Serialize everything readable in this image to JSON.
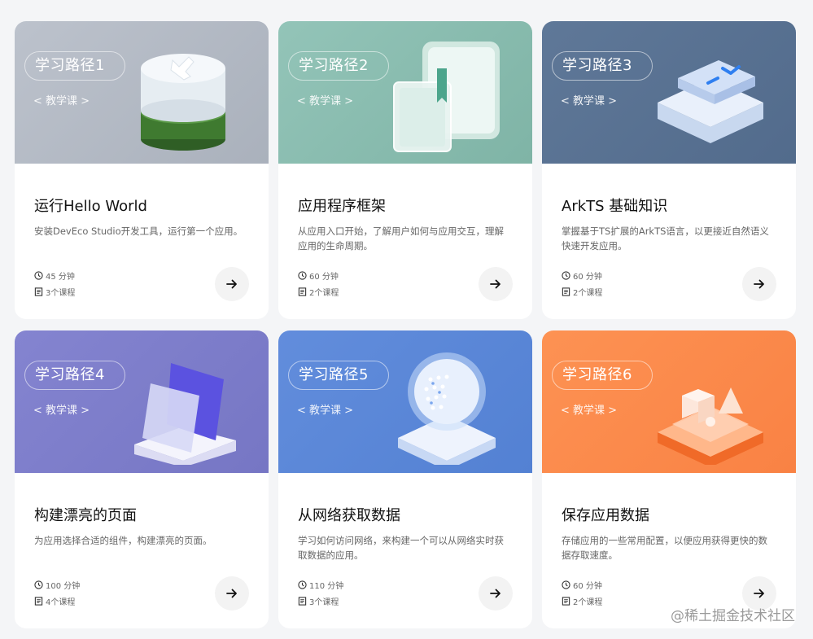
{
  "cards": [
    {
      "path": "学习路径1",
      "tag": "< 教学课 >",
      "title": "运行Hello World",
      "desc": "安装DevEco Studio开发工具，运行第一个应用。",
      "duration": "45 分钟",
      "courses": "3个课程",
      "bg": "#b9bfc8",
      "art_icon": "wrench-cylinder-icon"
    },
    {
      "path": "学习路径2",
      "tag": "< 教学课 >",
      "title": "应用程序框架",
      "desc": "从应用入口开始，了解用户如何与应用交互，理解应用的生命周期。",
      "duration": "60 分钟",
      "courses": "2个课程",
      "bg": "#8bbdb0",
      "art_icon": "bookmark-panel-icon"
    },
    {
      "path": "学习路径3",
      "tag": "< 教学课 >",
      "title": "ArkTS 基础知识",
      "desc": "掌握基于TS扩展的ArkTS语言，以更接近自然语义快速开发应用。",
      "duration": "60 分钟",
      "courses": "2个课程",
      "bg": "#5a7395",
      "art_icon": "code-stack-icon"
    },
    {
      "path": "学习路径4",
      "tag": "< 教学课 >",
      "title": "构建漂亮的页面",
      "desc": "为应用选择合适的组件，构建漂亮的页面。",
      "duration": "100 分钟",
      "courses": "4个课程",
      "bg": "#7e7ecb",
      "art_icon": "layered-panels-icon"
    },
    {
      "path": "学习路径5",
      "tag": "< 教学课 >",
      "title": "从网络获取数据",
      "desc": "学习如何访问网络，来构建一个可以从网络实时获取数据的应用。",
      "duration": "110 分钟",
      "courses": "3个课程",
      "bg": "#5b86d8",
      "art_icon": "globe-icon"
    },
    {
      "path": "学习路径6",
      "tag": "< 教学课 >",
      "title": "保存应用数据",
      "desc": "存储应用的一些常用配置，以便应用获得更快的数据存取速度。",
      "duration": "60 分钟",
      "courses": "2个课程",
      "bg": "#fb8a4b",
      "art_icon": "shapes-tray-icon"
    }
  ],
  "watermark": "@稀土掘金技术社区"
}
